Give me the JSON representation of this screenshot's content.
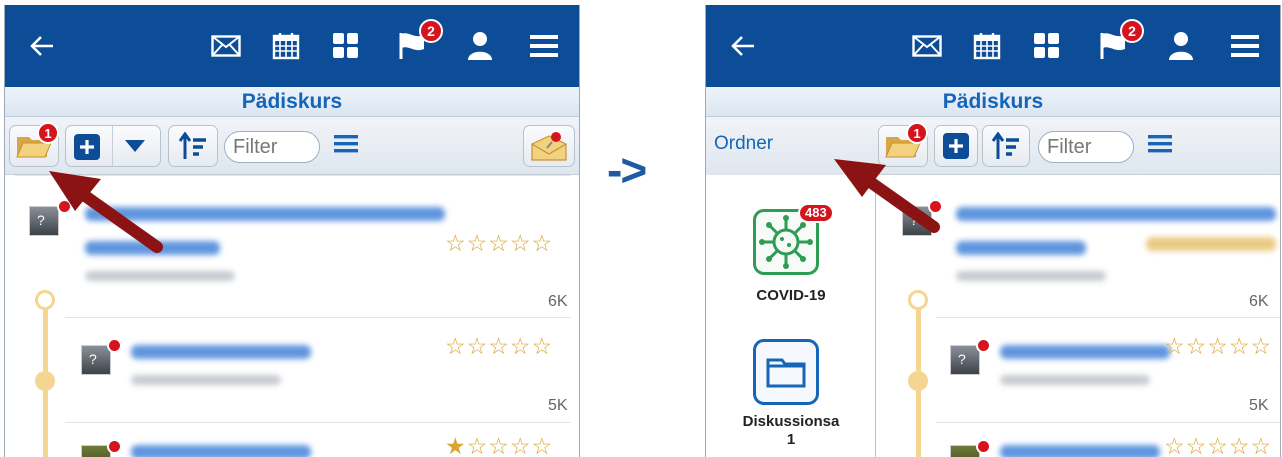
{
  "transition_arrow": "->",
  "left_screen": {
    "title": "Pädiskurs",
    "flag_badge": "2",
    "folder_badge": "1",
    "filter_placeholder": "Filter",
    "posts": [
      {
        "size": "6K",
        "stars_filled": 0
      },
      {
        "size": "5K",
        "stars_filled": 0
      },
      {
        "size": "",
        "stars_filled": 1
      }
    ]
  },
  "right_screen": {
    "title": "Pädiskurs",
    "flag_badge": "2",
    "folder_badge": "1",
    "filter_placeholder": "Filter",
    "folders_label": "Ordner",
    "folders": [
      {
        "name": "COVID-19",
        "count": "483",
        "icon": "virus-icon"
      },
      {
        "name": "Diskussionsa\n1",
        "count": "",
        "icon": "folder-icon"
      }
    ],
    "posts": [
      {
        "size": "6K"
      },
      {
        "size": "5K"
      }
    ]
  },
  "colors": {
    "topbar": "#0d4d97",
    "title": "#1565b8",
    "annotation_arrow": "#8b1313",
    "badge": "#d4151d",
    "star": "#d9a634",
    "covid_green": "#2f9c53"
  }
}
